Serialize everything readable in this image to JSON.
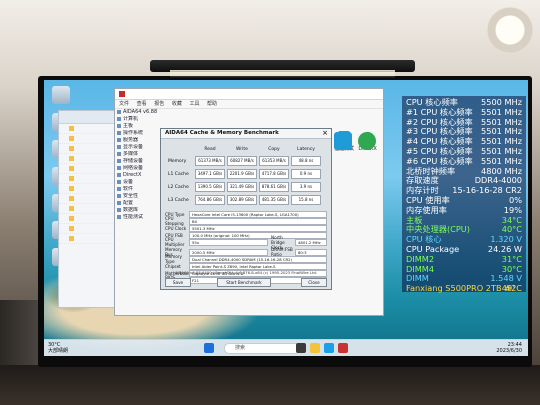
{
  "aida_window": {
    "title": "",
    "menu": [
      "文件",
      "查看",
      "报告",
      "收藏",
      "工具",
      "帮助"
    ],
    "tree": [
      "AIDA64 v6.88",
      "计算机",
      "主板",
      "操作系统",
      "服务器",
      "显示设备",
      "多媒体",
      "存储设备",
      "网络设备",
      "DirectX",
      "设备",
      "软件",
      "安全性",
      "配置",
      "数据库",
      "性能测试"
    ],
    "right_icons": [
      {
        "label": "性能测试",
        "icon": "benchmark-icon",
        "color": "#1f9bd7"
      },
      {
        "label": "DirectX",
        "icon": "xbox-icon",
        "color": "#2fa84f"
      }
    ]
  },
  "benchmark_dialog": {
    "title": "AIDA64 Cache & Memory Benchmark",
    "close": "×",
    "columns": [
      "Read",
      "Write",
      "Copy",
      "Latency"
    ],
    "rows": [
      {
        "label": "Memory",
        "values": [
          "61373 MB/s",
          "60827 MB/s",
          "61353 MB/s",
          "48.8 ns"
        ]
      },
      {
        "label": "L1 Cache",
        "values": [
          "3497.1 GB/s",
          "2201.9 GB/s",
          "4717.8 GB/s",
          "0.9 ns"
        ]
      },
      {
        "label": "L2 Cache",
        "values": [
          "1390.5 GB/s",
          "321.49 GB/s",
          "878.61 GB/s",
          "3.9 ns"
        ]
      },
      {
        "label": "L3 Cache",
        "values": [
          "764.86 GB/s",
          "302.89 GB/s",
          "481.35 GB/s",
          "15.8 ns"
        ]
      }
    ],
    "info": [
      {
        "k": "CPU Type",
        "v": "HexaCore Intel Core i5-13600 (Raptor Lake-S, LGA1700)"
      },
      {
        "k": "CPU Stepping",
        "v": "B0"
      },
      {
        "k": "CPU Clock",
        "v": "5501.3 MHz"
      },
      {
        "k": "CPU FSB",
        "v": "100.0 MHz (original: 100 MHz)"
      },
      {
        "k": "CPU Multiplier",
        "v": "55x",
        "k2": "North Bridge Clock",
        "v2": "4801.2 MHz"
      }
    ],
    "info2": [
      {
        "k": "Memory Bus",
        "v": "2000.5 MHz",
        "k2": "DRAM:FSB Ratio",
        "v2": "80:3"
      },
      {
        "k": "Memory Type",
        "v": "Dual Channel DDR4-4000 SDRAM (15-16-16-28 CR2)"
      },
      {
        "k": "Chipset",
        "v": "Intel Alder Point-S Z690, Intel Raptor Lake-S"
      },
      {
        "k": "Motherboard",
        "v": "Gigabyte Z690 UD DDR4-D"
      },
      {
        "k": "BIOS Version",
        "v": "F21"
      }
    ],
    "footer": "AIDA64 v6.88.6400 / BenchDLL 4.6.876.8-x64 (c) 1995-2023 FinalWire Ltd.",
    "buttons": {
      "save": "Save",
      "start": "Start Benchmark",
      "close": "Close"
    }
  },
  "taskbar": {
    "weather_line1": "30°C",
    "weather_line2": "大部晴朗",
    "search": "搜索",
    "time": "23:44",
    "date": "2023/6/30"
  },
  "osd": {
    "rows": [
      {
        "label": "CPU 核心频率",
        "value": "5500 MHz",
        "label_color": "#ffffff",
        "value_color": "#ffffff"
      },
      {
        "label": "#1 CPU 核心频率",
        "value": "5501 MHz",
        "label_color": "#ffffff",
        "value_color": "#ffffff"
      },
      {
        "label": "#2 CPU 核心频率",
        "value": "5501 MHz",
        "label_color": "#ffffff",
        "value_color": "#ffffff"
      },
      {
        "label": "#3 CPU 核心频率",
        "value": "5501 MHz",
        "label_color": "#ffffff",
        "value_color": "#ffffff"
      },
      {
        "label": "#4 CPU 核心频率",
        "value": "5501 MHz",
        "label_color": "#ffffff",
        "value_color": "#ffffff"
      },
      {
        "label": "#5 CPU 核心频率",
        "value": "5501 MHz",
        "label_color": "#ffffff",
        "value_color": "#ffffff"
      },
      {
        "label": "#6 CPU 核心频率",
        "value": "5501 MHz",
        "label_color": "#ffffff",
        "value_color": "#ffffff"
      },
      {
        "label": "北桥时钟频率",
        "value": "4800 MHz",
        "label_color": "#ffffff",
        "value_color": "#ffffff"
      },
      {
        "label": "存取速度",
        "value": "DDR4-4000",
        "label_color": "#ffffff",
        "value_color": "#ffffff"
      },
      {
        "label": "内存计时",
        "value": "15-16-16-28 CR2",
        "label_color": "#ffffff",
        "value_color": "#ffffff"
      },
      {
        "label": "CPU 使用率",
        "value": "0%",
        "label_color": "#ffffff",
        "value_color": "#ffffff"
      },
      {
        "label": "内存使用率",
        "value": "19%",
        "label_color": "#ffffff",
        "value_color": "#ffffff"
      },
      {
        "label": "主板",
        "value": "34°C",
        "label_color": "#7fff5a",
        "value_color": "#7fff5a"
      },
      {
        "label": "中央处理器(CPU)",
        "value": "40°C",
        "label_color": "#7fff5a",
        "value_color": "#7fff5a"
      },
      {
        "label": "CPU 核心",
        "value": "1.320 V",
        "label_color": "#5fd8ff",
        "value_color": "#5fd8ff"
      },
      {
        "label": "CPU Package",
        "value": "24.26 W",
        "label_color": "#ffffff",
        "value_color": "#ffffff"
      },
      {
        "label": "DIMM2",
        "value": "31°C",
        "label_color": "#7fff5a",
        "value_color": "#7fff5a"
      },
      {
        "label": "DIMM4",
        "value": "30°C",
        "label_color": "#7fff5a",
        "value_color": "#7fff5a"
      },
      {
        "label": "DIMM",
        "value": "1.548 V",
        "label_color": "#5fd8ff",
        "value_color": "#5fd8ff"
      },
      {
        "label": "Fanxiang S500PRO 2TB #2",
        "value": "49°C",
        "label_color": "#ffd84a",
        "value_color": "#ffd84a"
      }
    ]
  }
}
